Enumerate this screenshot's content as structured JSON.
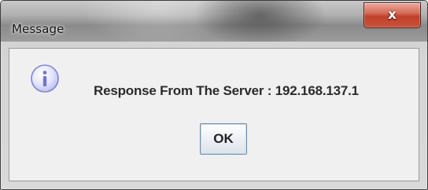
{
  "window": {
    "title": "Message",
    "close_glyph": "x"
  },
  "dialog": {
    "icon": "info-icon",
    "message": "Response From The Server : 192.168.137.1",
    "ok_label": "OK"
  },
  "colors": {
    "close_button": "#c8523a",
    "info_icon": "#8a8ed8",
    "ok_border": "#6d8fb5"
  }
}
